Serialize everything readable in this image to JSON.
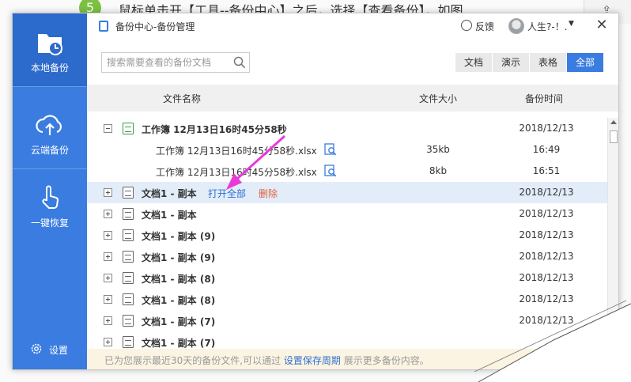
{
  "background": {
    "step_number": "5",
    "instruction_text": "鼠标单击开【工具--备份中心】之后，选择【查看备份】，如图"
  },
  "sidebar": {
    "items": [
      {
        "label": "本地备份",
        "icon": "folder-clock-icon",
        "active": true
      },
      {
        "label": "云端备份",
        "icon": "cloud-upload-icon",
        "active": false
      },
      {
        "label": "一键恢复",
        "icon": "hand-pointer-icon",
        "active": false
      }
    ],
    "settings_label": "设置"
  },
  "titlebar": {
    "title": "备份中心-备份管理",
    "feedback_label": "反馈",
    "user_name": "人生?-！.",
    "close_symbol": "✕"
  },
  "toolbar": {
    "search_placeholder": "搜索需要查看的备份文档",
    "filters": [
      {
        "label": "文档",
        "active": false
      },
      {
        "label": "演示",
        "active": false
      },
      {
        "label": "表格",
        "active": false
      },
      {
        "label": "全部",
        "active": true
      }
    ]
  },
  "table": {
    "headers": {
      "name": "文件名称",
      "size": "文件大小",
      "time": "备份时间"
    },
    "rows": [
      {
        "type": "group",
        "expanded": true,
        "file_type": "xls",
        "name": "工作簿 12月13日16时45分58秒",
        "date": "2018/12/13"
      },
      {
        "type": "child",
        "name": "工作簿 12月13日16时45分58秒.xlsx",
        "size": "35kb",
        "time": "16:49"
      },
      {
        "type": "child",
        "name": "工作簿 12月13日16时45分58秒.xlsx",
        "size": "8kb",
        "time": "16:51"
      },
      {
        "type": "group",
        "expanded": false,
        "file_type": "doc",
        "name": "文档1 - 副本",
        "date": "2018/12/13",
        "highlighted": true,
        "open_all_label": "打开全部",
        "delete_label": "删除"
      },
      {
        "type": "group",
        "expanded": false,
        "file_type": "doc",
        "name": "文档1 - 副本",
        "date": "2018/12/13"
      },
      {
        "type": "group",
        "expanded": false,
        "file_type": "doc",
        "name": "文档1 - 副本 (9)",
        "date": "2018/12/13"
      },
      {
        "type": "group",
        "expanded": false,
        "file_type": "doc",
        "name": "文档1 - 副本 (9)",
        "date": "2018/12/13"
      },
      {
        "type": "group",
        "expanded": false,
        "file_type": "doc",
        "name": "文档1 - 副本 (8)",
        "date": "2018/12/13"
      },
      {
        "type": "group",
        "expanded": false,
        "file_type": "doc",
        "name": "文档1 - 副本 (8)",
        "date": "2018/12/13"
      },
      {
        "type": "group",
        "expanded": false,
        "file_type": "doc",
        "name": "文档1 - 副本 (7)",
        "date": "2018/12/13"
      },
      {
        "type": "group",
        "expanded": false,
        "file_type": "doc",
        "name": "文档1 - 副本 (7)",
        "date": ""
      }
    ]
  },
  "footer": {
    "text_before": "已为您展示最近30天的备份文件,可以通过 ",
    "link": "设置保存周期",
    "text_after": " 展示更多备份内容。"
  },
  "colors": {
    "accent": "#3a7ce0",
    "sidebar_active": "#2c6acb",
    "row_highlight": "#e3ecf9",
    "delete": "#e0603a",
    "annotation_arrow": "#e83ad8"
  }
}
